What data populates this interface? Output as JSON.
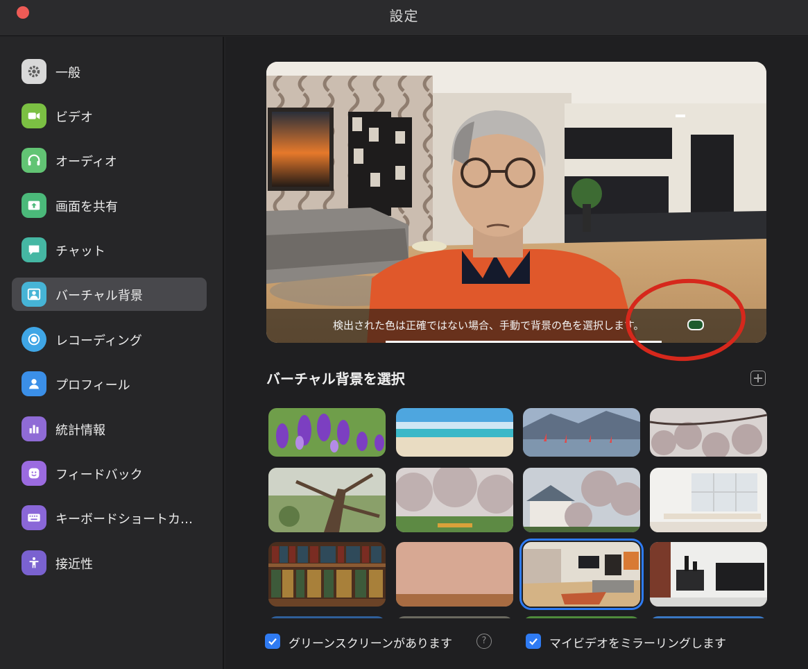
{
  "window": {
    "title": "設定"
  },
  "sidebar": {
    "items": [
      {
        "label": "一般",
        "icon": "gear-icon",
        "color": "#d9d9d9"
      },
      {
        "label": "ビデオ",
        "icon": "video-camera-icon",
        "color": "#7bc043"
      },
      {
        "label": "オーディオ",
        "icon": "headphones-icon",
        "color": "#62c474"
      },
      {
        "label": "画面を共有",
        "icon": "share-screen-icon",
        "color": "#4bb97a"
      },
      {
        "label": "チャット",
        "icon": "chat-bubble-icon",
        "color": "#45b7a3"
      },
      {
        "label": "バーチャル背景",
        "icon": "portrait-icon",
        "color": "#46b4d6",
        "active": true
      },
      {
        "label": "レコーディング",
        "icon": "record-icon",
        "color": "#3fa6e6"
      },
      {
        "label": "プロフィール",
        "icon": "person-icon",
        "color": "#3b8fe8"
      },
      {
        "label": "統計情報",
        "icon": "bar-chart-icon",
        "color": "#8f6bd6"
      },
      {
        "label": "フィードバック",
        "icon": "smiley-icon",
        "color": "#9b6be0"
      },
      {
        "label": "キーボードショートカ…",
        "icon": "keyboard-icon",
        "color": "#8a67d8"
      },
      {
        "label": "接近性",
        "icon": "accessibility-icon",
        "color": "#7a62d0"
      }
    ]
  },
  "preview": {
    "caption": "検出された色は正確ではない場合、手動で背景の色を選択します。",
    "background_color_swatch": "#1d5b2d",
    "annotation_color": "#d6281c"
  },
  "backgrounds": {
    "title": "バーチャル背景を選択",
    "add_icon": "plus-icon",
    "thumbnails": [
      {
        "name": "crocus-flowers"
      },
      {
        "name": "tropical-beach"
      },
      {
        "name": "windsurf-lake"
      },
      {
        "name": "cherry-blossom-branches"
      },
      {
        "name": "cherry-tree-trunk"
      },
      {
        "name": "cherry-blossom-park"
      },
      {
        "name": "cherry-blossom-house"
      },
      {
        "name": "white-room-windows"
      },
      {
        "name": "bookshelf"
      },
      {
        "name": "peach-wall-wood-floor"
      },
      {
        "name": "modern-living-room",
        "selected": true
      },
      {
        "name": "loft-interior"
      }
    ]
  },
  "options": {
    "green_screen_label": "グリーンスクリーンがあります",
    "green_screen_checked": true,
    "help_icon": "?",
    "mirror_label": "マイビデオをミラーリングします",
    "mirror_checked": true
  }
}
